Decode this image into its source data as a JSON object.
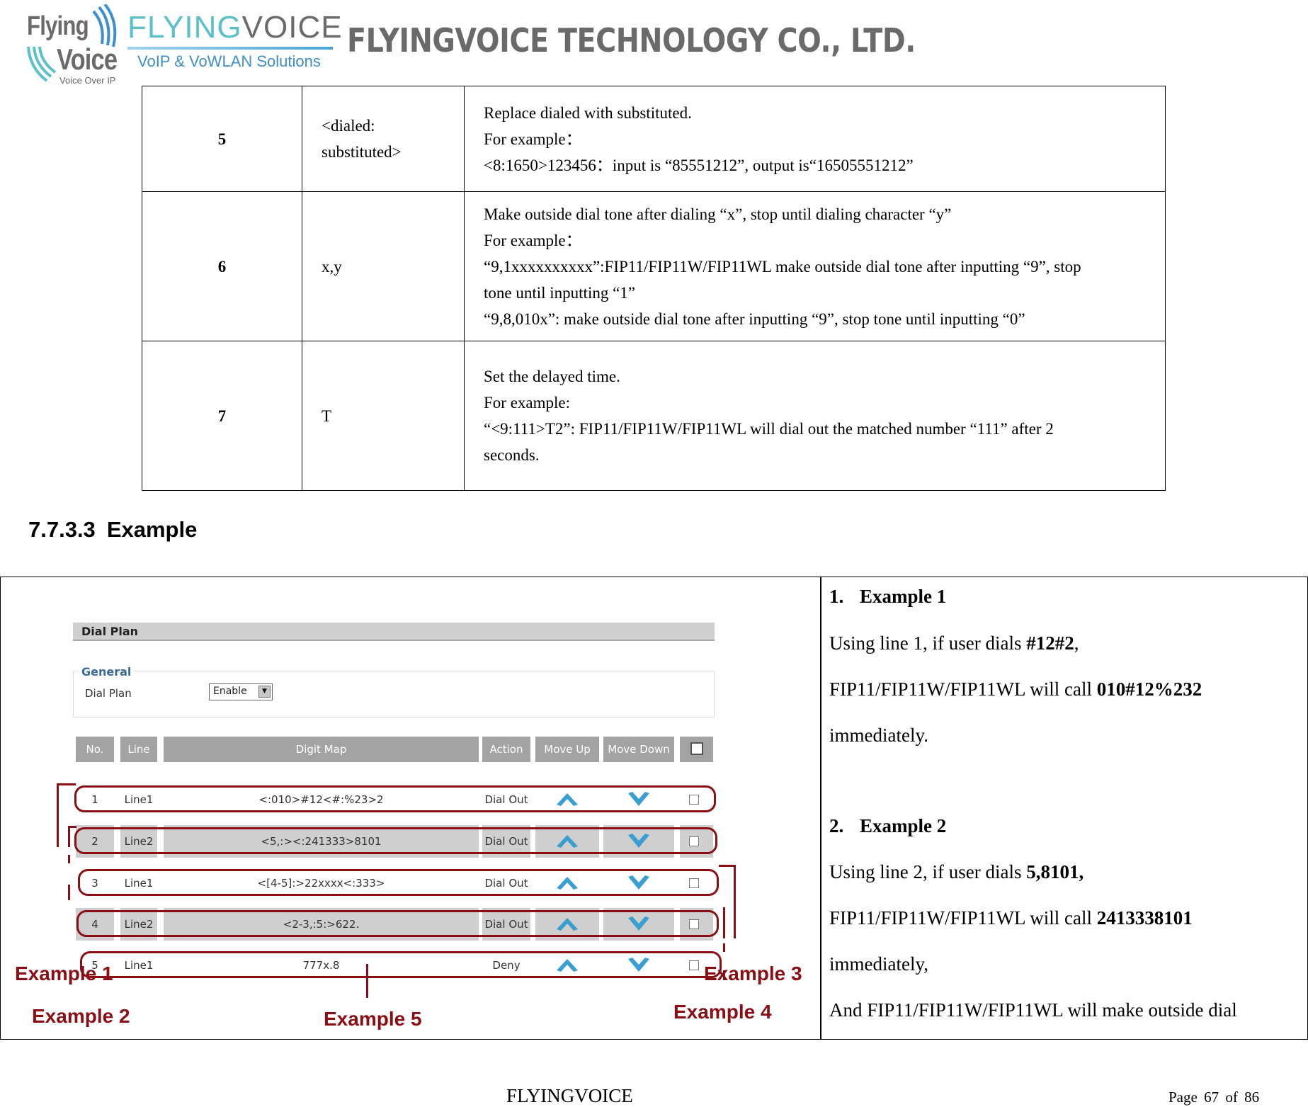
{
  "header": {
    "logo_left": {
      "line1": "Flying",
      "line2": "Voice",
      "tagline": "Voice Over IP"
    },
    "logo_center": {
      "part1": "FLYING",
      "part2": "VOICE",
      "tagline": "VoIP & VoWLAN Solutions"
    },
    "company_name": "FLYINGVOICE TECHNOLOGY CO., LTD.",
    "colors": {
      "teal": "#5bc0c8",
      "gray": "#6a6a6a",
      "blue": "#3f8fc6"
    }
  },
  "spec_table": {
    "rows": [
      {
        "num": "5",
        "symbol": [
          "<dialed:",
          "substituted>"
        ],
        "desc": [
          "Replace dialed with substituted.",
          "For example：",
          "<8:1650>123456：input is “85551212”, output is“16505551212”"
        ]
      },
      {
        "num": "6",
        "symbol": [
          "x,y"
        ],
        "desc": [
          "Make outside dial tone after dialing “x”, stop until dialing character “y”",
          "For example：",
          "“9,1xxxxxxxxxx”:FIP11/FIP11W/FIP11WL make outside dial tone after inputting “9”, stop",
          "tone until inputting “1”",
          "“9,8,010x”: make outside dial tone after inputting “9”, stop tone until inputting “0”"
        ]
      },
      {
        "num": "7",
        "symbol": [
          "T"
        ],
        "desc": [
          "Set the delayed time.",
          "For example:",
          "“<9:111>T2”: FIP11/FIP11W/FIP11WL will dial out the matched number “111” after 2",
          "seconds."
        ]
      }
    ]
  },
  "section": {
    "number": "7.7.3.3",
    "title": "Example"
  },
  "dial_plan_screenshot": {
    "title": "Dial Plan",
    "general_legend": "General",
    "dial_plan_label": "Dial Plan",
    "dial_plan_value": "Enable",
    "columns": [
      "No.",
      "Line",
      "Digit Map",
      "Action",
      "Move Up",
      "Move Down",
      ""
    ],
    "rows": [
      {
        "no": "1",
        "line": "Line1",
        "digit_map": "<:010>#12<#:%23>2",
        "action": "Dial Out"
      },
      {
        "no": "2",
        "line": "Line2",
        "digit_map": "<5,:><:241333>8101",
        "action": "Dial Out"
      },
      {
        "no": "3",
        "line": "Line1",
        "digit_map": "<[4-5]:>22xxxx<:333>",
        "action": "Dial Out"
      },
      {
        "no": "4",
        "line": "Line2",
        "digit_map": "<2-3,:5:>622.",
        "action": "Dial Out"
      },
      {
        "no": "5",
        "line": "Line1",
        "digit_map": "777x.8",
        "action": "Deny"
      }
    ],
    "callouts": [
      "Example 1",
      "Example 2",
      "Example 3",
      "Example 4",
      "Example 5"
    ],
    "colors": {
      "annotation": "#8a0f14",
      "header_bg": "#a3a3a3",
      "band": "#cfcfcf",
      "arrow": "#3a9fd0"
    }
  },
  "notes": {
    "example1": {
      "index": "1.",
      "title": "Example 1",
      "line1_pre": "Using line 1, if user dials ",
      "line1_bold": "#12#2",
      "line1_post": ",",
      "line2_pre": "FIP11/FIP11W/FIP11WL will call ",
      "line2_bold": "010#12%232",
      "line3": "immediately."
    },
    "example2": {
      "index": "2.",
      "title": "Example 2",
      "line1_pre": "Using line 2, if user dials ",
      "line1_bold": "5,8101,",
      "line2_pre": "FIP11/FIP11W/FIP11WL will call ",
      "line2_bold": "2413338101",
      "line3": "immediately,",
      "line4": "And FIP11/FIP11W/FIP11WL will make outside dial"
    }
  },
  "footer": {
    "brand": "FLYINGVOICE",
    "page_label": "Page",
    "page": "67",
    "of_label": "of",
    "total": "86"
  }
}
